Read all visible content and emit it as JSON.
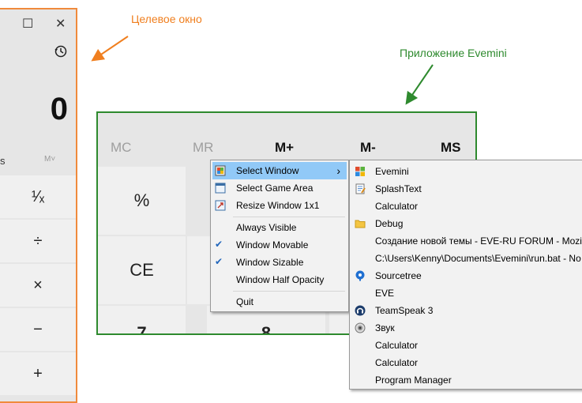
{
  "annotations": {
    "target_window": "Целевое окно",
    "evemini_app": "Приложение Evemini"
  },
  "colors": {
    "target_border": "#f08a3c",
    "app_border": "#2e8a2e",
    "highlight": "#91c9f7"
  },
  "target_calc": {
    "display": "0",
    "mem_s": "s",
    "mem_m": "M˅",
    "keys": [
      "¹⁄ₓ",
      "÷",
      "×",
      "−",
      "+"
    ]
  },
  "evemini_calc": {
    "memory": [
      "MC",
      "MR",
      "M+",
      "M-",
      "MS"
    ],
    "keys": {
      "percent": "%",
      "ce": "CE",
      "seven": "7",
      "eight": "8"
    }
  },
  "context_menu": {
    "items": [
      {
        "label": "Select Window",
        "icon": "windows-tile-icon",
        "checked": false,
        "submenu": true
      },
      {
        "label": "Select Game Area",
        "icon": "window-frame-icon",
        "checked": false
      },
      {
        "label": "Resize Window 1x1",
        "icon": "resize-icon",
        "checked": false
      },
      {
        "label": "Always Visible",
        "checked": false
      },
      {
        "label": "Window Movable",
        "checked": true
      },
      {
        "label": "Window Sizable",
        "checked": true
      },
      {
        "label": "Window Half Opacity",
        "checked": false
      },
      {
        "label": "Quit",
        "checked": false
      }
    ],
    "submenu_arrow": "›"
  },
  "submenu": {
    "items": [
      {
        "label": "Evemini",
        "icon": "windows-logo-icon"
      },
      {
        "label": "SplashText",
        "icon": "notepad-icon"
      },
      {
        "label": "Calculator",
        "icon": ""
      },
      {
        "label": "Debug",
        "icon": "folder-icon"
      },
      {
        "label": "Создание новой темы - EVE-RU FORUM - Mozilla",
        "icon": ""
      },
      {
        "label": "C:\\Users\\Kenny\\Documents\\Evemini\\run.bat - No",
        "icon": ""
      },
      {
        "label": "Sourcetree",
        "icon": "sourcetree-icon"
      },
      {
        "label": "EVE",
        "icon": ""
      },
      {
        "label": "TeamSpeak 3",
        "icon": "teamspeak-icon"
      },
      {
        "label": "Звук",
        "icon": "speaker-icon"
      },
      {
        "label": "Calculator",
        "icon": ""
      },
      {
        "label": "Calculator",
        "icon": ""
      },
      {
        "label": "Program Manager",
        "icon": ""
      }
    ]
  }
}
